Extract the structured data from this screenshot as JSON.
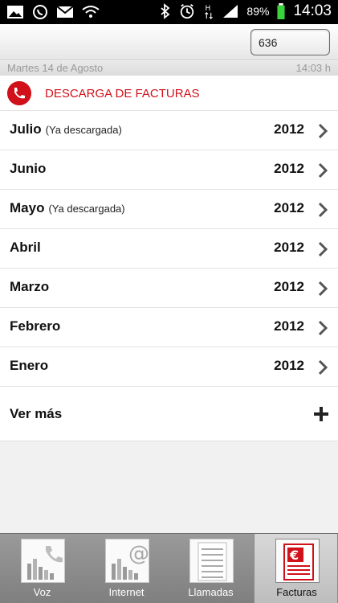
{
  "statusbar": {
    "battery_percent": "89%",
    "time": "14:03"
  },
  "header": {
    "line_selector_value": "636"
  },
  "datebar": {
    "date": "Martes 14 de Agosto",
    "time": "14:03 h"
  },
  "section": {
    "title": "DESCARGA DE FACTURAS"
  },
  "invoices": [
    {
      "month": "Julio",
      "note": "(Ya descargada)",
      "year": "2012"
    },
    {
      "month": "Junio",
      "note": "",
      "year": "2012"
    },
    {
      "month": "Mayo",
      "note": "(Ya descargada)",
      "year": "2012"
    },
    {
      "month": "Abril",
      "note": "",
      "year": "2012"
    },
    {
      "month": "Marzo",
      "note": "",
      "year": "2012"
    },
    {
      "month": "Febrero",
      "note": "",
      "year": "2012"
    },
    {
      "month": "Enero",
      "note": "",
      "year": "2012"
    }
  ],
  "more": {
    "label": "Ver más"
  },
  "bottom_nav": [
    {
      "label": "Voz",
      "icon": "phone-chart-icon",
      "active": false
    },
    {
      "label": "Internet",
      "icon": "at-chart-icon",
      "active": false
    },
    {
      "label": "Llamadas",
      "icon": "call-list-icon",
      "active": false
    },
    {
      "label": "Facturas",
      "icon": "euro-invoice-icon",
      "active": true
    }
  ],
  "colors": {
    "accent": "#d0111b"
  }
}
